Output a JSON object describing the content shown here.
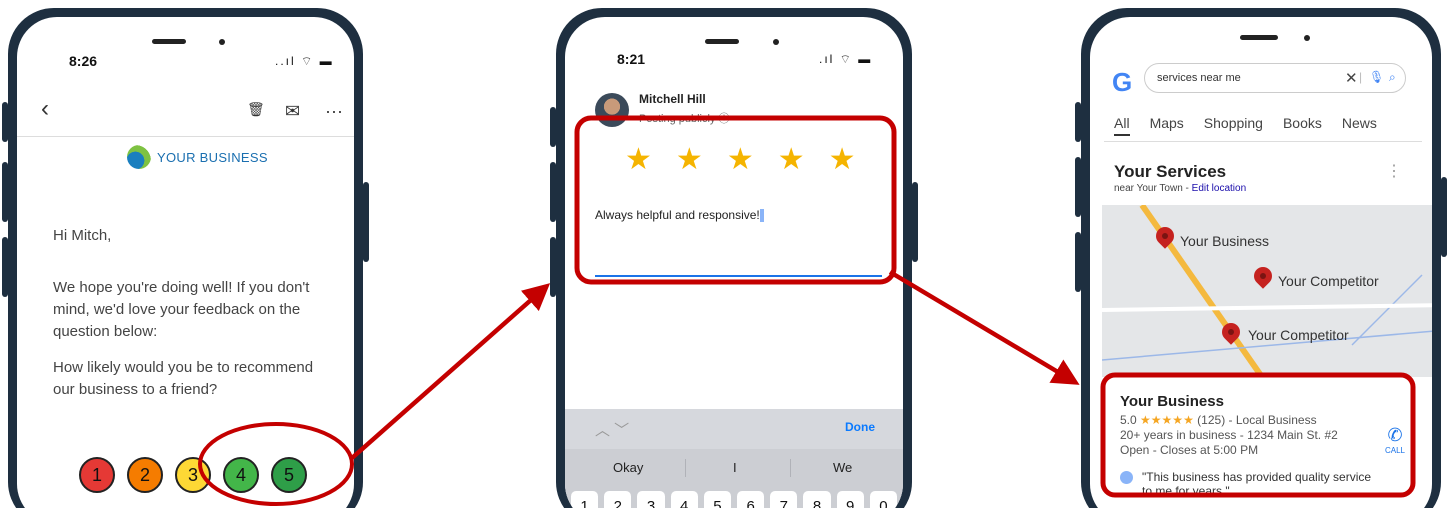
{
  "phone1": {
    "time": "8:26",
    "status": "..ıl ⌔ ▬",
    "toolbar": {
      "back": "‹",
      "trash": "🗑",
      "mail": "✉",
      "more": "···"
    },
    "brand": "YOUR BUSINESS",
    "greeting": "Hi Mitch,",
    "body": "We hope you're doing well! If you don't mind, we'd love your feedback on the question below:",
    "question": "How likely would you be to recommend our business to a friend?",
    "ratings": [
      {
        "label": "1",
        "color": "#e53935"
      },
      {
        "label": "2",
        "color": "#f57c00"
      },
      {
        "label": "3",
        "color": "#fdd835"
      },
      {
        "label": "4",
        "color": "#43b649"
      },
      {
        "label": "5",
        "color": "#2e9e48"
      }
    ]
  },
  "phone2": {
    "time": "8:21",
    "status": ".ıl ⌔ ▬",
    "reviewer": "Mitchell Hill",
    "posting": "Posting publicly ⓘ",
    "stars": [
      "★",
      "★",
      "★",
      "★",
      "★"
    ],
    "review_text": "Always helpful and responsive!",
    "keyboard": {
      "arrows": "︿  ﹀",
      "done": "Done",
      "suggestions": [
        "Okay",
        "I",
        "We"
      ],
      "keys": [
        "1",
        "2",
        "3",
        "4",
        "5",
        "6",
        "7",
        "8",
        "9",
        "0"
      ]
    }
  },
  "phone3": {
    "search_query": "services near me",
    "clear": "✕",
    "divider": "|",
    "mic": "🎙",
    "lens": "⌕",
    "tabs": [
      "All",
      "Maps",
      "Shopping",
      "Books",
      "News"
    ],
    "services_title": "Your Services",
    "near_prefix": "near Your Town - ",
    "edit_location": "Edit location",
    "kebab": "⋮",
    "map_pins": [
      "Your Business",
      "Your Competitor",
      "Your Competitor"
    ],
    "listing": {
      "name": "Your Business",
      "rating": "5.0",
      "stars": "★★★★★",
      "reviews": "(125) - Local Business",
      "years": "20+ years in business - 1234 Main St. #2",
      "hours": "Open - Closes at 5:00 PM",
      "quote": "\"This business has provided quality service to me for years.\"",
      "call_label": "CALL",
      "call_icon": "✆"
    }
  },
  "colors": {
    "highlight": "#c40000",
    "phone_frame": "#1e2f40",
    "star": "#f5b400",
    "link": "#1a0dab"
  }
}
